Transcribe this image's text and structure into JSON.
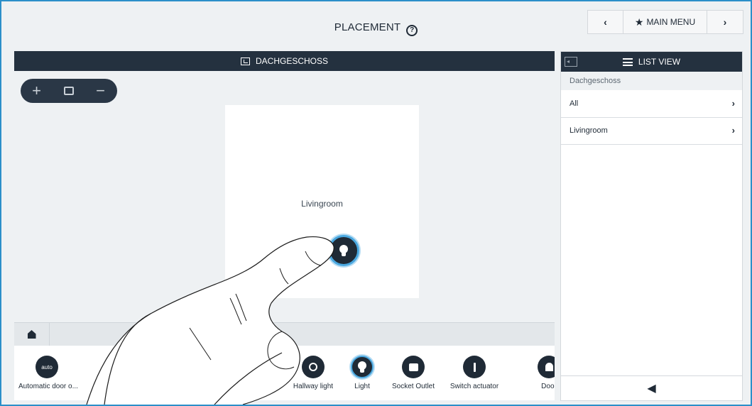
{
  "header": {
    "title": "PLACEMENT",
    "help_glyph": "?"
  },
  "nav": {
    "prev_glyph": "‹",
    "main_menu_label": "MAIN MENU",
    "next_glyph": "›"
  },
  "floorplan": {
    "bar_title": "DACHGESCHOSS",
    "room_label": "Livingroom"
  },
  "device_bar": {
    "selector_label": "device"
  },
  "tray": [
    {
      "label": "Automatic door o...",
      "icon": "auto-door-icon",
      "glyph": "auto"
    },
    {
      "label": "Hallway light",
      "icon": "hallway-light-icon",
      "glyph": ""
    },
    {
      "label": "Light",
      "icon": "light-bulb-icon",
      "glyph": ""
    },
    {
      "label": "Socket Outlet",
      "icon": "socket-outlet-icon",
      "glyph": ""
    },
    {
      "label": "Switch actuator",
      "icon": "switch-actuator-icon",
      "glyph": ""
    },
    {
      "label": "Door",
      "icon": "door-bell-icon",
      "glyph": ""
    }
  ],
  "list_view": {
    "title": "LIST VIEW",
    "section": "Dachgeschoss",
    "items": [
      {
        "label": "All"
      },
      {
        "label": "Livingroom"
      }
    ]
  },
  "colors": {
    "accent": "#4aa8e0",
    "dark": "#24313f",
    "border": "#2b8fc9"
  }
}
